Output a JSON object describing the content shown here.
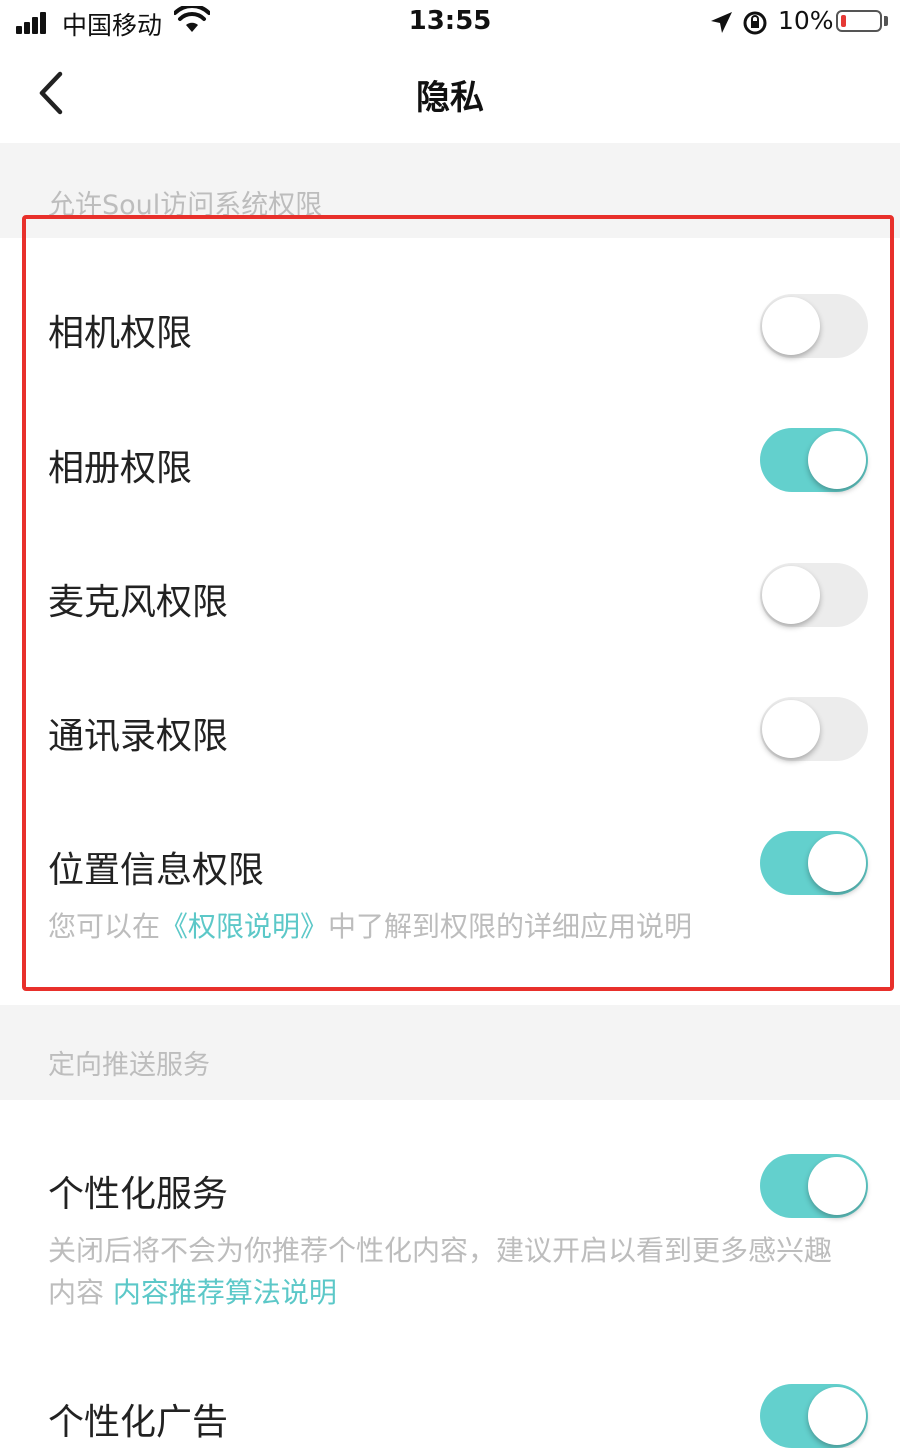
{
  "status_bar": {
    "carrier": "中国移动",
    "time": "13:55",
    "battery": "10%",
    "icons": [
      "signal-icon",
      "wifi-icon",
      "location-arrow-icon",
      "orientation-lock-icon",
      "battery-icon"
    ]
  },
  "nav": {
    "back_icon": "chevron-left-icon",
    "title": "隐私"
  },
  "sections": {
    "system_permissions": {
      "header": "允许Soul访问系统权限",
      "rows": [
        {
          "label": "相机权限",
          "on": false
        },
        {
          "label": "相册权限",
          "on": true
        },
        {
          "label": "麦克风权限",
          "on": false
        },
        {
          "label": "通讯录权限",
          "on": false
        },
        {
          "label": "位置信息权限",
          "on": true
        }
      ],
      "footer_prefix": "您可以在",
      "footer_link": "《权限说明》",
      "footer_suffix": "中了解到权限的详细应用说明"
    },
    "targeted_push": {
      "header": "定向推送服务",
      "rows": [
        {
          "label": "个性化服务",
          "on": true,
          "desc": "关闭后将不会为你推荐个性化内容，建议开启以看到更多感兴趣内容",
          "desc_link": "内容推荐算法说明"
        },
        {
          "label": "个性化广告",
          "on": true
        }
      ]
    }
  },
  "colors": {
    "toggle_on": "#63d0cd",
    "toggle_off": "#ececec",
    "link": "#5cc8c8",
    "highlight": "#e8302b",
    "section_bg": "#f4f4f4"
  }
}
